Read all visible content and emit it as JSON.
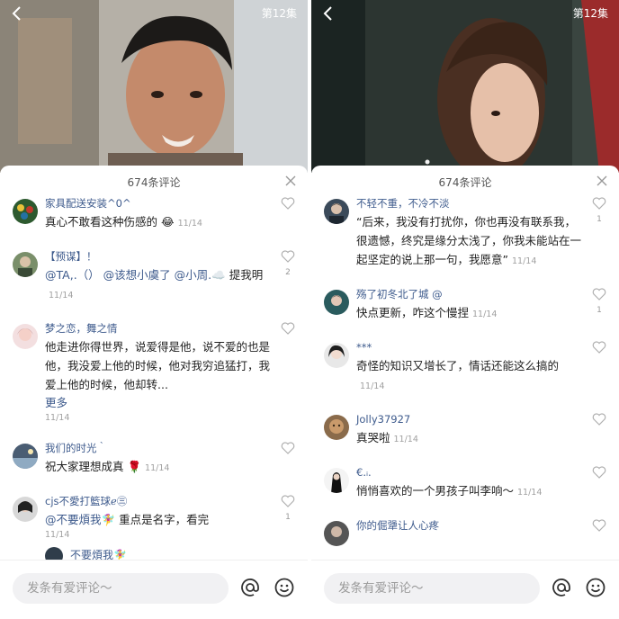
{
  "panels": [
    {
      "episode": "第12集",
      "count": "674条评论",
      "input_placeholder": "发条有爱评论～",
      "comments": [
        {
          "user": "家具配送安装^0^",
          "text": "真心不敢看这种伤感的 😂",
          "time": "11/14",
          "likes": ""
        },
        {
          "user": "【预谋】！",
          "text_a": "@TA,.（）",
          "text_b": "@该想小虞了",
          "text_c": "@小周.☁️",
          "text_d": "提我明",
          "time": "11/14",
          "likes": "2"
        },
        {
          "user": "梦之恋，舞之情",
          "text": "他走进你得世界，说爱得是他，说不爱的也是他，我没爱上他的时候，他对我穷追猛打，我爱上他的时候，他却转...",
          "more": "更多",
          "time": "11/14",
          "likes": ""
        },
        {
          "user": "我们的时光｀",
          "text": "祝大家理想成真 🌹",
          "time": "11/14",
          "likes": ""
        },
        {
          "user": "cjs不愛打籃球ℯ㊂",
          "text_a": "@不要煩我🧚‍♀",
          "text_b": "重点是名字，看完",
          "time": "11/14",
          "likes": "1",
          "reply_user": "不要煩我🧚‍♀"
        }
      ]
    },
    {
      "episode": "第12集",
      "count": "674条评论",
      "input_placeholder": "发条有爱评论～",
      "comments": [
        {
          "user": "不轻不重，不冷不淡",
          "text": "“后来，我没有打扰你，你也再没有联系我，很遗憾，终究是缘分太浅了，你我未能站在一起坚定的说上那一句，我愿意”",
          "time": "11/14",
          "likes": "1"
        },
        {
          "user": "殇了初冬北了城",
          "user_suffix": "@",
          "text": "快点更新，咋这个慢捏",
          "time": "11/14",
          "likes": "1"
        },
        {
          "user": "***",
          "text": "奇怪的知识又增长了，情话还能这么搞的",
          "time": "11/14",
          "likes": ""
        },
        {
          "user": "Jolly37927",
          "text": "真哭啦",
          "time": "11/14",
          "likes": ""
        },
        {
          "user": "€.ᵢ.",
          "text": "悄悄喜欢的一个男孩子叫李响～",
          "time": "11/14",
          "likes": ""
        },
        {
          "user": "你的倔犟让人心疼",
          "text": "",
          "time": "",
          "likes": ""
        }
      ]
    }
  ],
  "colors": {
    "mention": "#3d5a8c",
    "time": "#a0a0a0",
    "input_bg": "#f1f1f3"
  }
}
